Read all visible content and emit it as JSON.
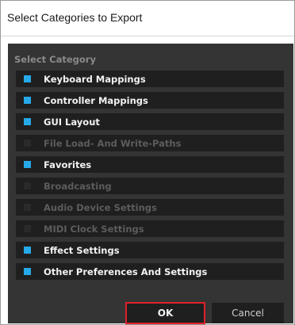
{
  "window": {
    "title": "Select Categories to Export"
  },
  "panel": {
    "section_label": "Select Category",
    "categories": [
      {
        "label": "Keyboard Mappings",
        "checked": true
      },
      {
        "label": "Controller Mappings",
        "checked": true
      },
      {
        "label": "GUI Layout",
        "checked": true
      },
      {
        "label": "File Load- And Write-Paths",
        "checked": false
      },
      {
        "label": "Favorites",
        "checked": true
      },
      {
        "label": "Broadcasting",
        "checked": false
      },
      {
        "label": "Audio Device Settings",
        "checked": false
      },
      {
        "label": "MIDI Clock Settings",
        "checked": false
      },
      {
        "label": "Effect Settings",
        "checked": true
      },
      {
        "label": "Other Preferences And Settings",
        "checked": true
      }
    ]
  },
  "buttons": {
    "ok_label": "OK",
    "cancel_label": "Cancel"
  },
  "colors": {
    "checkbox_checked": "#26a9e9",
    "panel_bg": "#343434",
    "row_bg": "#1f1f1f",
    "ok_highlight": "#e0202a"
  }
}
